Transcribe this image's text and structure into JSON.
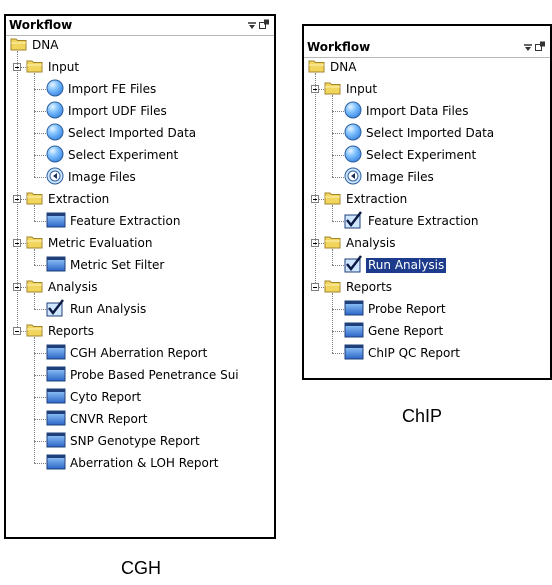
{
  "cgh": {
    "title": "Workflow",
    "root": "DNA",
    "groups": [
      {
        "label": "Input",
        "items": [
          {
            "label": "Import FE Files",
            "icon": "blue-sphere-icon"
          },
          {
            "label": "Import UDF Files",
            "icon": "blue-sphere-icon"
          },
          {
            "label": "Select Imported Data",
            "icon": "blue-sphere-icon"
          },
          {
            "label": "Select Experiment",
            "icon": "blue-sphere-icon"
          },
          {
            "label": "Image Files",
            "icon": "image-disc-icon"
          }
        ]
      },
      {
        "label": "Extraction",
        "items": [
          {
            "label": "Feature Extraction",
            "icon": "report-icon"
          }
        ]
      },
      {
        "label": "Metric Evaluation",
        "items": [
          {
            "label": "Metric Set Filter",
            "icon": "report-icon"
          }
        ]
      },
      {
        "label": "Analysis",
        "items": [
          {
            "label": "Run Analysis",
            "icon": "checkmark-icon"
          }
        ]
      },
      {
        "label": "Reports",
        "items": [
          {
            "label": "CGH Aberration Report",
            "icon": "report-icon"
          },
          {
            "label": "Probe Based Penetrance Sui",
            "icon": "report-icon"
          },
          {
            "label": "Cyto Report",
            "icon": "report-icon"
          },
          {
            "label": "CNVR Report",
            "icon": "report-icon"
          },
          {
            "label": "SNP Genotype Report",
            "icon": "report-icon"
          },
          {
            "label": "Aberration & LOH Report",
            "icon": "report-icon"
          }
        ]
      }
    ],
    "caption": "CGH"
  },
  "chip": {
    "title": "Workflow",
    "root": "DNA",
    "groups": [
      {
        "label": "Input",
        "items": [
          {
            "label": "Import Data Files",
            "icon": "blue-sphere-icon"
          },
          {
            "label": "Select Imported Data",
            "icon": "blue-sphere-icon"
          },
          {
            "label": "Select Experiment",
            "icon": "blue-sphere-icon"
          },
          {
            "label": "Image Files",
            "icon": "image-disc-icon"
          }
        ]
      },
      {
        "label": "Extraction",
        "items": [
          {
            "label": "Feature Extraction",
            "icon": "checkmark-icon"
          }
        ]
      },
      {
        "label": "Analysis",
        "items": [
          {
            "label": "Run Analysis",
            "icon": "checkmark-icon",
            "selected": true
          }
        ]
      },
      {
        "label": "Reports",
        "items": [
          {
            "label": "Probe Report",
            "icon": "report-icon"
          },
          {
            "label": "Gene Report",
            "icon": "report-icon"
          },
          {
            "label": "ChIP QC Report",
            "icon": "report-icon"
          }
        ]
      }
    ],
    "caption": "ChIP"
  },
  "colors": {
    "selection": "#1d3b8c",
    "folder": "#f2d55c",
    "sphere": "#3a86e0",
    "report": "#2b65c7"
  }
}
